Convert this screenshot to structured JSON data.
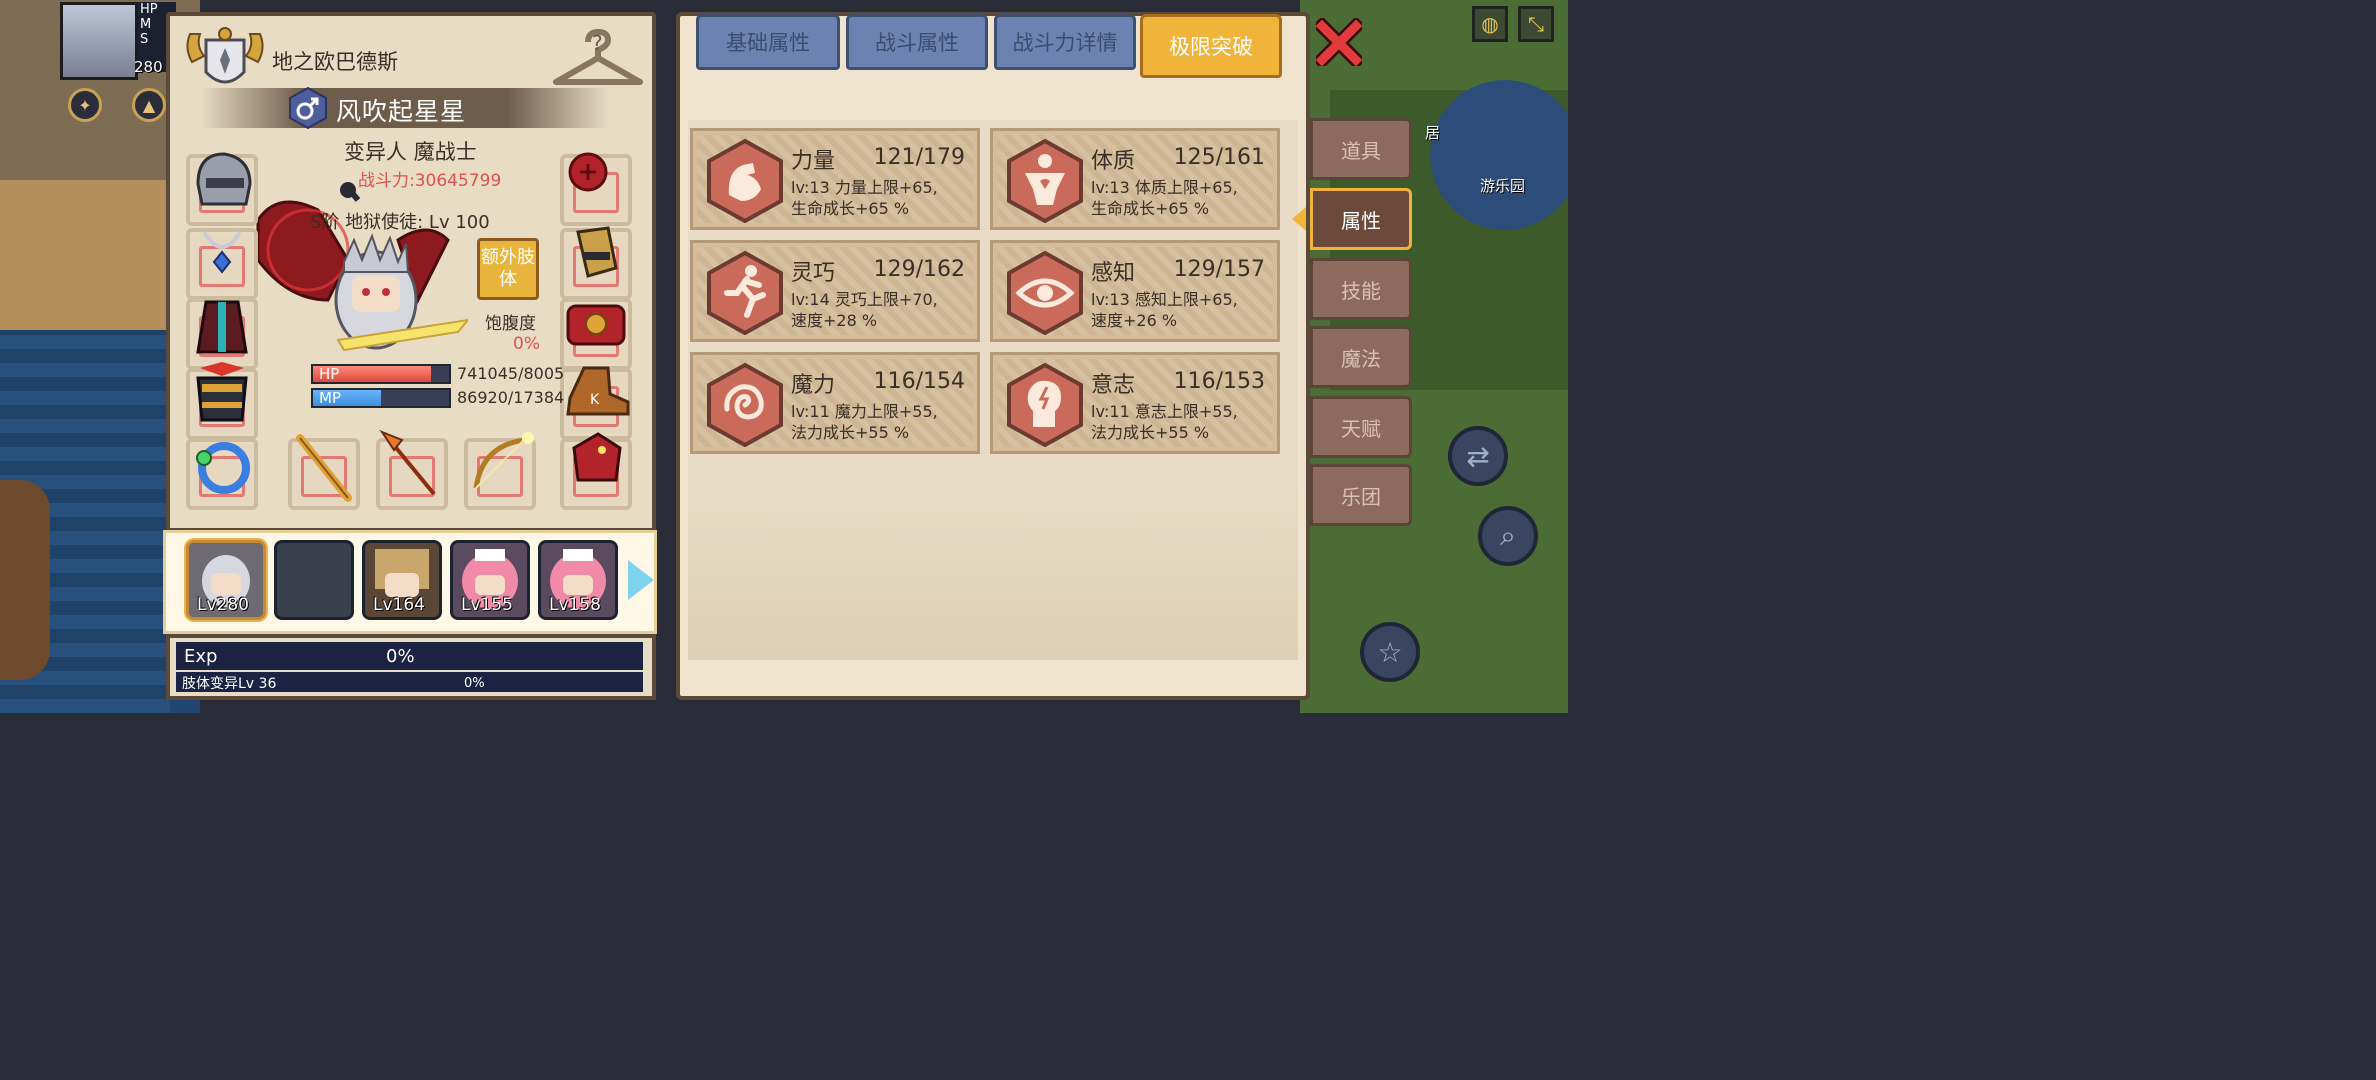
{
  "hud": {
    "hp_short": "HP",
    "mp_short": "M",
    "s_short": "S",
    "level": "280"
  },
  "character": {
    "guild": "地之欧巴德斯",
    "name": "风吹起星星",
    "class": "变异人 魔战士",
    "power": "战斗力:30645799",
    "rank_title": "S阶 地狱使徒: Lv 100",
    "extra_limb_label": "额外肢体",
    "satiety_label": "饱腹度",
    "satiety_value": "0%",
    "hp_label": "HP",
    "hp_value": "741045/8005",
    "hp_fraction": 0.87,
    "mp_label": "MP",
    "mp_value": "86920/17384",
    "mp_fraction": 0.5
  },
  "party": [
    {
      "level": "Lv280",
      "active": true
    },
    {
      "level": "",
      "active": false
    },
    {
      "level": "Lv164",
      "active": false
    },
    {
      "level": "Lv155",
      "active": false
    },
    {
      "level": "Lv158",
      "active": false
    }
  ],
  "exp": {
    "label": "Exp",
    "value": "0%",
    "limb_label": "肢体变异Lv 36",
    "limb_value": "0%"
  },
  "tabs": [
    {
      "label": "基础属性",
      "active": false
    },
    {
      "label": "战斗属性",
      "active": false
    },
    {
      "label": "战斗力详情",
      "active": false
    },
    {
      "label": "极限突破",
      "active": true
    }
  ],
  "attributes": [
    {
      "name": "力量",
      "value": "121/179",
      "line1": "lv:13 力量上限+65,",
      "line2": "生命成长+65 %",
      "icon": "strength-arm-icon"
    },
    {
      "name": "体质",
      "value": "125/161",
      "line1": "lv:13 体质上限+65,",
      "line2": "生命成长+65 %",
      "icon": "constitution-body-icon"
    },
    {
      "name": "灵巧",
      "value": "129/162",
      "line1": "lv:14 灵巧上限+70,",
      "line2": "速度+28 %",
      "icon": "agility-runner-icon"
    },
    {
      "name": "感知",
      "value": "129/157",
      "line1": "lv:13 感知上限+65,",
      "line2": "速度+26 %",
      "icon": "perception-eye-icon"
    },
    {
      "name": "魔力",
      "value": "116/154",
      "line1": "lv:11 魔力上限+55,",
      "line2": "法力成长+55 %",
      "icon": "magic-spiral-icon"
    },
    {
      "name": "意志",
      "value": "116/153",
      "line1": "lv:11 意志上限+55,",
      "line2": "法力成长+55 %",
      "icon": "will-head-icon"
    }
  ],
  "side_tabs": [
    {
      "label": "道具",
      "active": false
    },
    {
      "label": "属性",
      "active": true
    },
    {
      "label": "技能",
      "active": false
    },
    {
      "label": "魔法",
      "active": false
    },
    {
      "label": "天赋",
      "active": false
    },
    {
      "label": "乐团",
      "active": false
    }
  ],
  "map": {
    "park_label": "游乐园",
    "side_label": "居"
  },
  "colors": {
    "panel_bg": "#e9dcc5",
    "accent_gold": "#f0b43b",
    "tab_blue": "#6c83b1",
    "power_red": "#d9544c",
    "hp_red": "#d94a3c",
    "mp_blue": "#3a8ddc"
  }
}
